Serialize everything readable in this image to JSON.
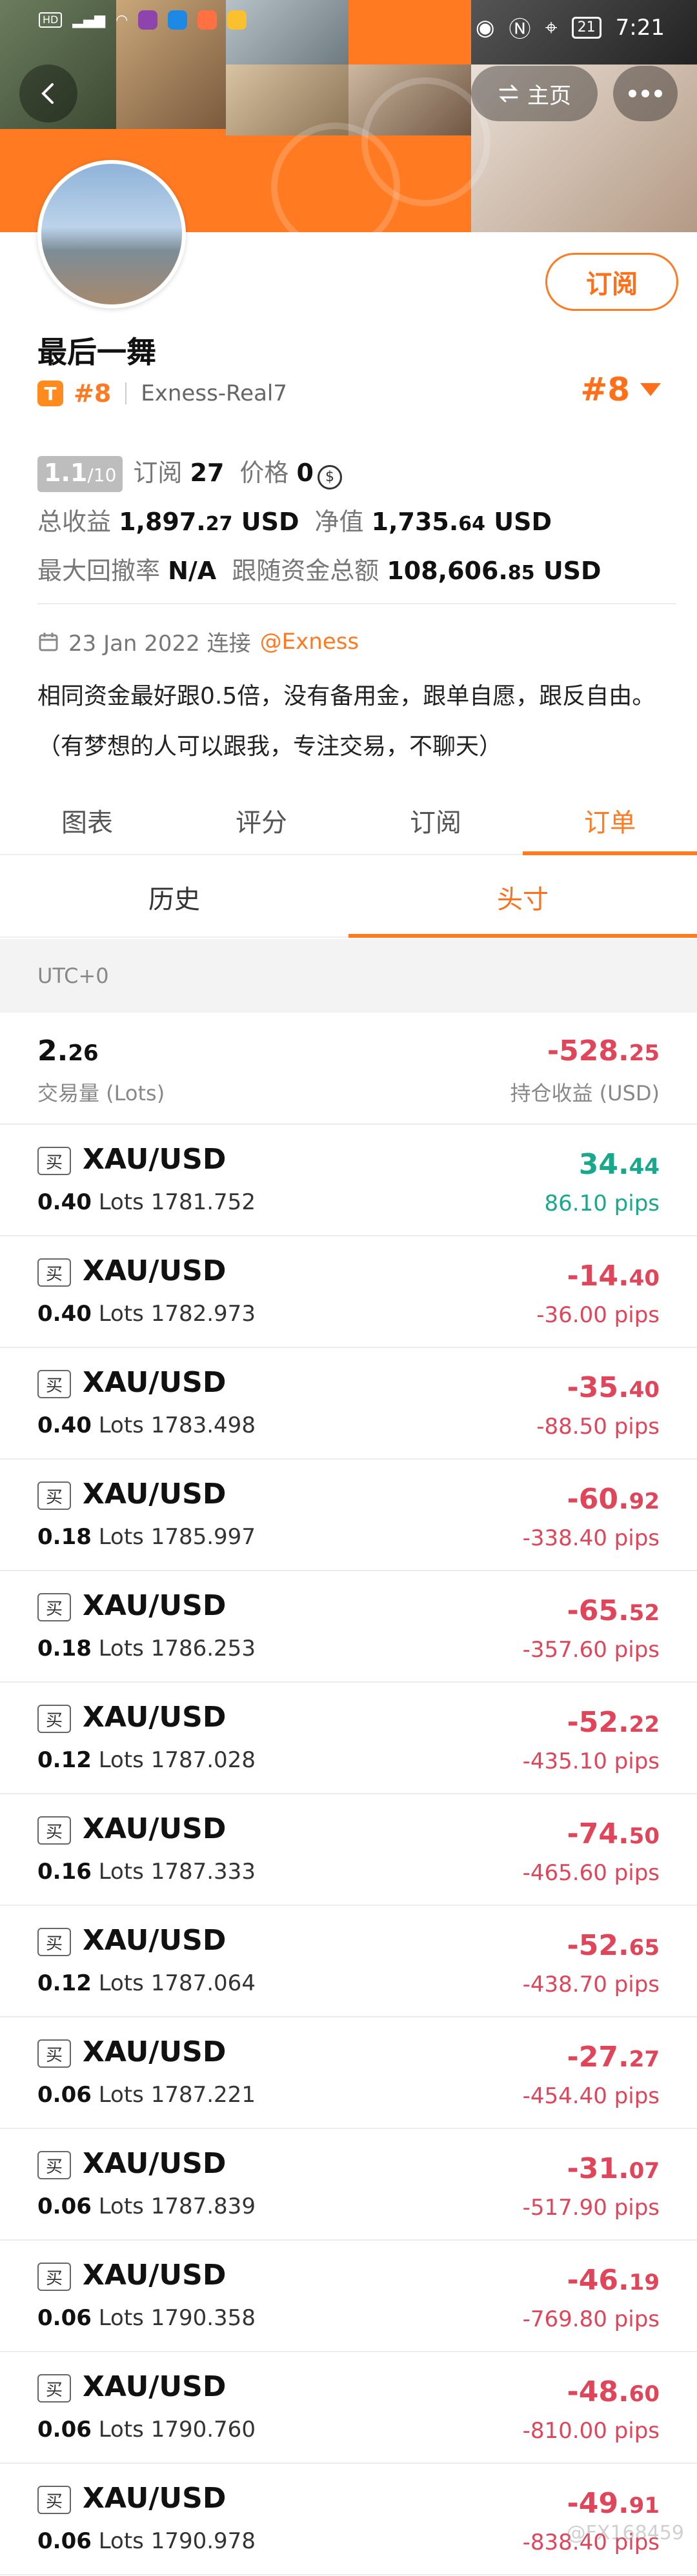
{
  "status_bar": {
    "time": "7:21",
    "battery": "21",
    "left_icons": [
      "hd-icon",
      "signal-icon",
      "wifi-icon",
      "app-icons"
    ]
  },
  "header": {
    "home_label": "主页",
    "colors": {
      "accent": "#ff7a21",
      "positive": "#1aa88c",
      "negative": "#e0455a"
    }
  },
  "profile": {
    "name": "最后一舞",
    "badge": "T",
    "rank_small": "#8",
    "account": "Exness-Real7",
    "rank_big": "#8",
    "subscribe_label": "订阅",
    "score_main": "1.1",
    "score_total": "/10",
    "subscribe_text": "订阅",
    "subscribe_count": "27",
    "price_text": "价格",
    "price_value": "0",
    "total_profit_label": "总收益",
    "total_profit_int": "1,897.",
    "total_profit_dec": "27",
    "total_profit_unit": "USD",
    "net_label": "净值",
    "net_int": "1,735.",
    "net_dec": "64",
    "net_unit": "USD",
    "drawdown_label": "最大回撤率",
    "drawdown_value": "N/A",
    "follow_label": "跟随资金总额",
    "follow_int": "108,606.",
    "follow_dec": "85",
    "follow_unit": "USD",
    "connect_date": "23 Jan 2022 连接",
    "connect_link": "@Exness",
    "desc1": "相同资金最好跟0.5倍，没有备用金，跟单自愿，跟反自由。",
    "desc2": "（有梦想的人可以跟我，专注交易，不聊天）"
  },
  "tabs": [
    "图表",
    "评分",
    "订阅",
    "订单"
  ],
  "subtabs": [
    "历史",
    "头寸"
  ],
  "timezone": "UTC+0",
  "summary": {
    "volume_int": "2.",
    "volume_dec": "26",
    "volume_label": "交易量 (Lots)",
    "pnl_int": "-528.",
    "pnl_dec": "25",
    "pnl_label": "持仓收益 (USD)"
  },
  "orders": [
    {
      "tag": "买",
      "symbol": "XAU/USD",
      "lots": "0.40",
      "lots_unit": "Lots",
      "price": "1781.752",
      "profit_int": "34.",
      "profit_dec": "44",
      "pips": "86.10 pips",
      "sign": "pos"
    },
    {
      "tag": "买",
      "symbol": "XAU/USD",
      "lots": "0.40",
      "lots_unit": "Lots",
      "price": "1782.973",
      "profit_int": "-14.",
      "profit_dec": "40",
      "pips": "-36.00 pips",
      "sign": "neg"
    },
    {
      "tag": "买",
      "symbol": "XAU/USD",
      "lots": "0.40",
      "lots_unit": "Lots",
      "price": "1783.498",
      "profit_int": "-35.",
      "profit_dec": "40",
      "pips": "-88.50 pips",
      "sign": "neg"
    },
    {
      "tag": "买",
      "symbol": "XAU/USD",
      "lots": "0.18",
      "lots_unit": "Lots",
      "price": "1785.997",
      "profit_int": "-60.",
      "profit_dec": "92",
      "pips": "-338.40 pips",
      "sign": "neg"
    },
    {
      "tag": "买",
      "symbol": "XAU/USD",
      "lots": "0.18",
      "lots_unit": "Lots",
      "price": "1786.253",
      "profit_int": "-65.",
      "profit_dec": "52",
      "pips": "-357.60 pips",
      "sign": "neg"
    },
    {
      "tag": "买",
      "symbol": "XAU/USD",
      "lots": "0.12",
      "lots_unit": "Lots",
      "price": "1787.028",
      "profit_int": "-52.",
      "profit_dec": "22",
      "pips": "-435.10 pips",
      "sign": "neg"
    },
    {
      "tag": "买",
      "symbol": "XAU/USD",
      "lots": "0.16",
      "lots_unit": "Lots",
      "price": "1787.333",
      "profit_int": "-74.",
      "profit_dec": "50",
      "pips": "-465.60 pips",
      "sign": "neg"
    },
    {
      "tag": "买",
      "symbol": "XAU/USD",
      "lots": "0.12",
      "lots_unit": "Lots",
      "price": "1787.064",
      "profit_int": "-52.",
      "profit_dec": "65",
      "pips": "-438.70 pips",
      "sign": "neg"
    },
    {
      "tag": "买",
      "symbol": "XAU/USD",
      "lots": "0.06",
      "lots_unit": "Lots",
      "price": "1787.221",
      "profit_int": "-27.",
      "profit_dec": "27",
      "pips": "-454.40 pips",
      "sign": "neg"
    },
    {
      "tag": "买",
      "symbol": "XAU/USD",
      "lots": "0.06",
      "lots_unit": "Lots",
      "price": "1787.839",
      "profit_int": "-31.",
      "profit_dec": "07",
      "pips": "-517.90 pips",
      "sign": "neg"
    },
    {
      "tag": "买",
      "symbol": "XAU/USD",
      "lots": "0.06",
      "lots_unit": "Lots",
      "price": "1790.358",
      "profit_int": "-46.",
      "profit_dec": "19",
      "pips": "-769.80 pips",
      "sign": "neg"
    },
    {
      "tag": "买",
      "symbol": "XAU/USD",
      "lots": "0.06",
      "lots_unit": "Lots",
      "price": "1790.760",
      "profit_int": "-48.",
      "profit_dec": "60",
      "pips": "-810.00 pips",
      "sign": "neg"
    },
    {
      "tag": "买",
      "symbol": "XAU/USD",
      "lots": "0.06",
      "lots_unit": "Lots",
      "price": "1790.978",
      "profit_int": "-49.",
      "profit_dec": "91",
      "pips": "-838.40 pips",
      "sign": "neg"
    }
  ],
  "watermark": "@FX168459"
}
